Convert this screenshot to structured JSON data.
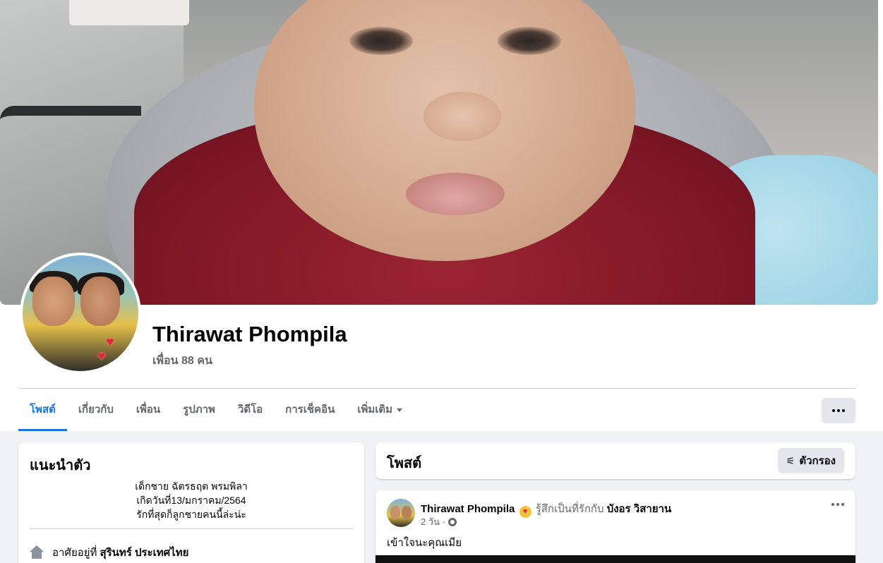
{
  "profile": {
    "name": "Thirawat Phompila",
    "friends_count": "เพื่อน 88 คน"
  },
  "tabs": [
    {
      "label": "โพสต์",
      "active": true
    },
    {
      "label": "เกี่ยวกับ"
    },
    {
      "label": "เพื่อน"
    },
    {
      "label": "รูปภาพ"
    },
    {
      "label": "วิดีโอ"
    },
    {
      "label": "การเช็คอิน"
    },
    {
      "label": "เพิ่มเติม"
    }
  ],
  "intro": {
    "title": "แนะนำตัว",
    "bio_lines": [
      "เด็กชาย ฉัตรธฤต พรมพิลา",
      "เกิดวันที่13/มกราคม/2564",
      "รักที่สุดก็ลูกชายคนนี้ล่ะน่ะ"
    ],
    "lives_in_prefix": "อาศัยอยู่ที่",
    "lives_in_place": "สุรินทร์ ประเทศไทย"
  },
  "posts": {
    "title": "โพสต์",
    "filter_label": "ตัวกรอง"
  },
  "post": {
    "author": "Thirawat Phompila",
    "feeling": "รู้สึกเป็นที่รักกับ",
    "with": "บังอร วิสายาน",
    "time": "2 วัน ·",
    "text": "เข้าใจนะคุณเมีย"
  },
  "colors": {
    "accent": "#1b74e4",
    "secondary_text": "#65676b",
    "background": "#f0f2f5"
  }
}
